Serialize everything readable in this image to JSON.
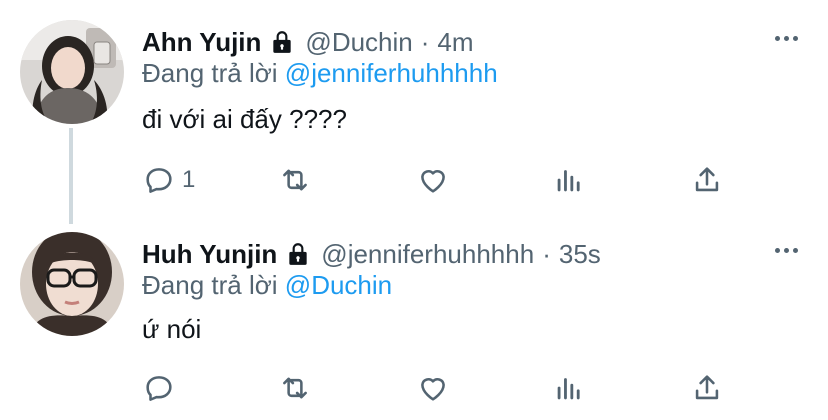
{
  "tweets": [
    {
      "display_name": "Ahn Yujin",
      "handle": "@Duchin",
      "separator": "·",
      "time": "4m",
      "reply_prefix": "Đang trả lời",
      "reply_to": "@jenniferhuhhhhh",
      "text": "đi với ai đấy ????",
      "reply_count": "1",
      "icons": [
        "lock-icon",
        "comment-icon",
        "retweet-icon",
        "heart-icon",
        "bar-chart-icon",
        "share-icon",
        "more-icon"
      ]
    },
    {
      "display_name": "Huh Yunjin",
      "handle": "@jenniferhuhhhhh",
      "separator": "·",
      "time": "35s",
      "reply_prefix": "Đang trả lời",
      "reply_to": "@Duchin",
      "text": "ứ nói",
      "reply_count": "",
      "icons": [
        "lock-icon",
        "comment-icon",
        "retweet-icon",
        "heart-icon",
        "bar-chart-icon",
        "share-icon",
        "more-icon"
      ]
    }
  ],
  "colors": {
    "text_primary": "#0f1419",
    "text_secondary": "#536471",
    "mention": "#1d9bf0",
    "thread_line": "#cfd9de"
  }
}
